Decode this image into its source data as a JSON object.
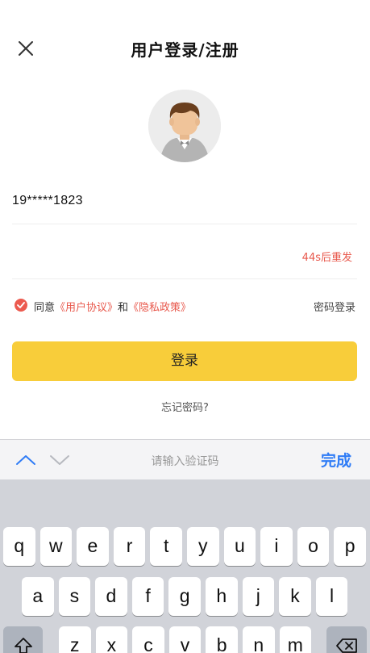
{
  "header": {
    "title": "用户登录/注册",
    "close_icon": "close-icon"
  },
  "avatar": {
    "icon": "user-avatar-icon"
  },
  "form": {
    "phone_value": "19*****1823",
    "resend_label": "44s后重发"
  },
  "agreement": {
    "checked": true,
    "prefix": "同意",
    "user_agreement": "《用户协议》",
    "conjunction": "和",
    "privacy_policy": "《隐私政策》",
    "password_login": "密码登录"
  },
  "login_button": "登录",
  "forgot_password": "忘记密码?",
  "keyboard_toolbar": {
    "placeholder": "请输入验证码",
    "done": "完成"
  },
  "keyboard": {
    "row1": [
      "q",
      "w",
      "e",
      "r",
      "t",
      "y",
      "u",
      "i",
      "o",
      "p"
    ],
    "row2": [
      "a",
      "s",
      "d",
      "f",
      "g",
      "h",
      "j",
      "k",
      "l"
    ],
    "row3": [
      "z",
      "x",
      "c",
      "v",
      "b",
      "n",
      "m"
    ],
    "shift_icon": "shift-icon",
    "backspace_icon": "backspace-icon"
  },
  "colors": {
    "accent_yellow": "#f8cd3a",
    "link_red": "#e8584c",
    "done_blue": "#2f7cf6"
  }
}
